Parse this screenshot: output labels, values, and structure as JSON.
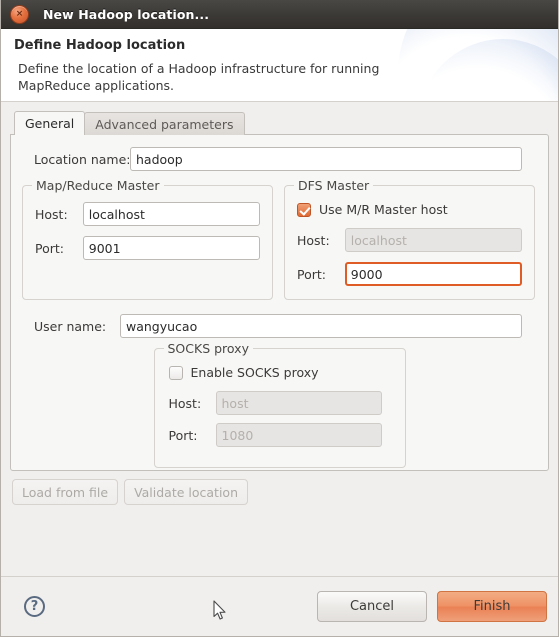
{
  "window": {
    "title": "New Hadoop location...",
    "close_icon": "close-icon",
    "close_glyph": "×"
  },
  "banner": {
    "title": "Define Hadoop location",
    "description": "Define the location of a Hadoop infrastructure for running\nMapReduce applications."
  },
  "tabs": [
    {
      "label": "General",
      "selected": true
    },
    {
      "label": "Advanced parameters",
      "selected": false
    }
  ],
  "general": {
    "location_name": {
      "label": "Location name:",
      "value": "hadoop"
    },
    "mr_master": {
      "title": "Map/Reduce Master",
      "host": {
        "label": "Host:",
        "value": "localhost"
      },
      "port": {
        "label": "Port:",
        "value": "9001"
      }
    },
    "dfs_master": {
      "title": "DFS Master",
      "use_mr_host": {
        "label": "Use M/R Master host",
        "checked": true
      },
      "host": {
        "label": "Host:",
        "value": "localhost",
        "disabled": true
      },
      "port": {
        "label": "Port:",
        "value": "9000",
        "focused": true
      }
    },
    "user_name": {
      "label": "User name:",
      "value": "wangyucao"
    },
    "socks_proxy": {
      "title": "SOCKS proxy",
      "enable": {
        "label": "Enable SOCKS proxy",
        "checked": false
      },
      "host": {
        "label": "Host:",
        "placeholder": "host",
        "disabled": true
      },
      "port": {
        "label": "Port:",
        "placeholder": "1080",
        "disabled": true
      }
    }
  },
  "actions": {
    "load_from_file": "Load from file",
    "validate_location": "Validate location"
  },
  "footer": {
    "help_glyph": "?",
    "cancel": "Cancel",
    "finish": "Finish"
  },
  "colors": {
    "accent_orange": "#e06a33",
    "finish_button": "#ef9266",
    "focus_border": "#e05c26",
    "titlebar": "#3b3936"
  }
}
